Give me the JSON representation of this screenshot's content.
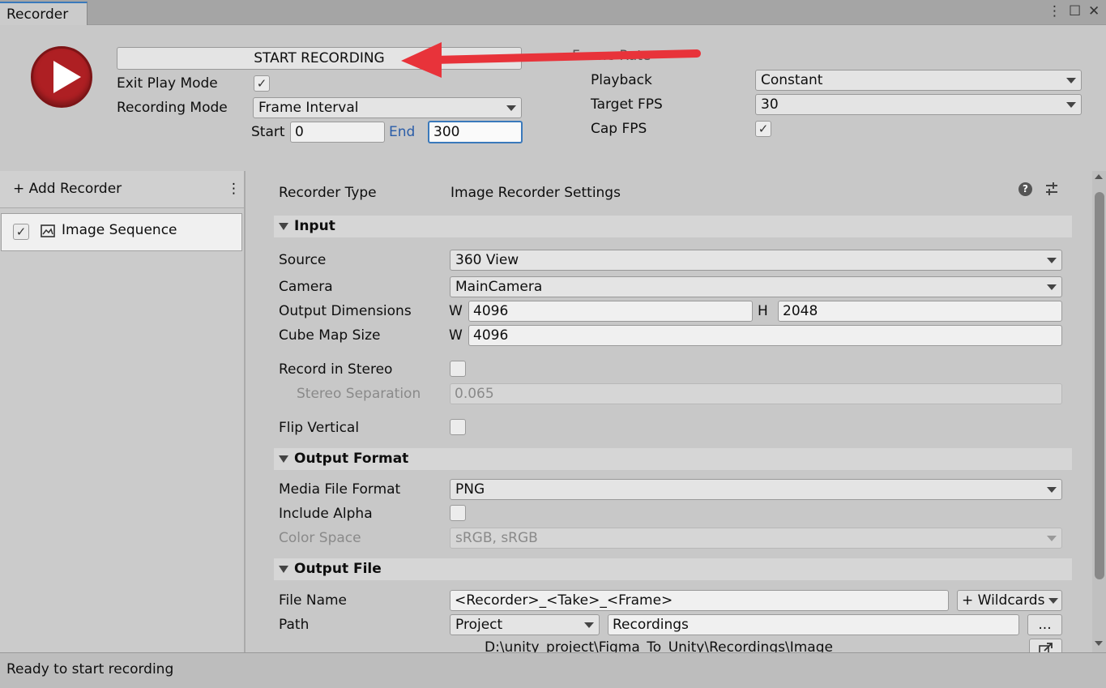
{
  "window": {
    "tab_title": "Recorder",
    "menu_glyph": "⋮",
    "maximize_glyph": "☐",
    "close_glyph": "✕"
  },
  "controls": {
    "start_recording_label": "START RECORDING",
    "exit_play_mode_label": "Exit Play Mode",
    "exit_play_mode_checked": true,
    "recording_mode_label": "Recording Mode",
    "recording_mode_value": "Frame Interval",
    "start_label": "Start",
    "start_value": "0",
    "end_label": "End",
    "end_value": "300",
    "frame_rate_label": "Frame Rate",
    "playback_label": "Playback",
    "playback_value": "Constant",
    "target_fps_label": "Target FPS",
    "target_fps_value": "30",
    "cap_fps_label": "Cap FPS",
    "cap_fps_checked": true
  },
  "sidebar": {
    "add_recorder_label": "+ Add Recorder",
    "more_glyph": "⋮",
    "items": [
      {
        "label": "Image Sequence",
        "checked": true
      }
    ]
  },
  "settings": {
    "recorder_type_label": "Recorder Type",
    "recorder_type_value": "Image Recorder Settings",
    "help_glyph": "?",
    "input_section": "Input",
    "source_label": "Source",
    "source_value": "360 View",
    "camera_label": "Camera",
    "camera_value": "MainCamera",
    "output_dimensions_label": "Output Dimensions",
    "w_label": "W",
    "h_label": "H",
    "output_width": "4096",
    "output_height": "2048",
    "cube_map_size_label": "Cube Map Size",
    "cube_map_width": "4096",
    "record_in_stereo_label": "Record in Stereo",
    "stereo_separation_label": "Stereo Separation",
    "stereo_separation_value": "0.065",
    "flip_vertical_label": "Flip Vertical",
    "output_format_section": "Output Format",
    "media_file_format_label": "Media File Format",
    "media_file_format_value": "PNG",
    "include_alpha_label": "Include Alpha",
    "color_space_label": "Color Space",
    "color_space_value": "sRGB, sRGB",
    "output_file_section": "Output File",
    "file_name_label": "File Name",
    "file_name_value": "<Recorder>_<Take>_<Frame>",
    "wildcards_label": "+ Wildcards",
    "path_label": "Path",
    "path_root_value": "Project",
    "path_folder_value": "Recordings",
    "browse_label": "...",
    "full_path": "D:\\unity_project\\Figma_To_Unity\\Recordings\\Image"
  },
  "status": {
    "message": "Ready to start recording"
  }
}
